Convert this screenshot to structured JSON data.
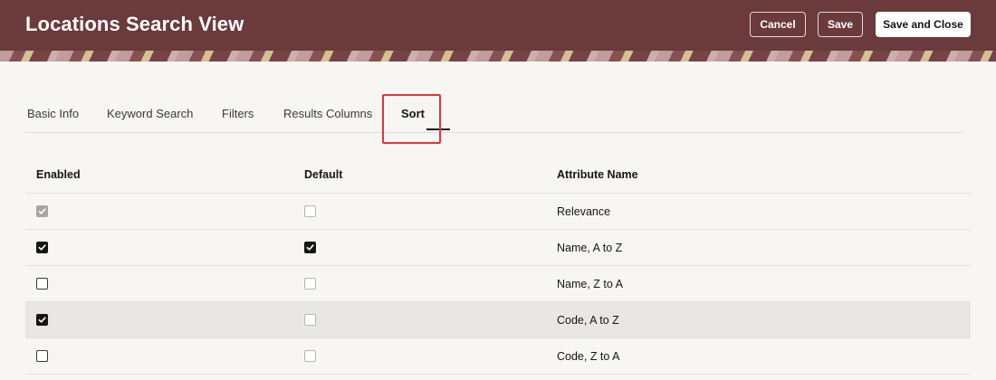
{
  "header": {
    "title": "Locations Search View",
    "cancel_label": "Cancel",
    "save_label": "Save",
    "save_close_label": "Save and Close"
  },
  "tabs": [
    {
      "label": "Basic Info"
    },
    {
      "label": "Keyword Search"
    },
    {
      "label": "Filters"
    },
    {
      "label": "Results Columns"
    },
    {
      "label": "Sort",
      "active": true
    }
  ],
  "table": {
    "columns": [
      "Enabled",
      "Default",
      "Attribute Name"
    ],
    "rows": [
      {
        "enabled": "disabled-checked",
        "default": "disabled",
        "attribute": "Relevance"
      },
      {
        "enabled": "checked",
        "default": "checked",
        "attribute": "Name, A to Z"
      },
      {
        "enabled": "empty",
        "default": "disabled",
        "attribute": "Name, Z to A"
      },
      {
        "enabled": "checked",
        "default": "disabled",
        "attribute": "Code, A to Z"
      },
      {
        "enabled": "empty",
        "default": "disabled",
        "attribute": "Code, Z to A"
      }
    ]
  },
  "colors": {
    "header_bg": "#6b3a3c",
    "highlight": "#e0343c",
    "page_bg": "#f8f6f3"
  },
  "icons": [
    "checkmark-icon"
  ]
}
